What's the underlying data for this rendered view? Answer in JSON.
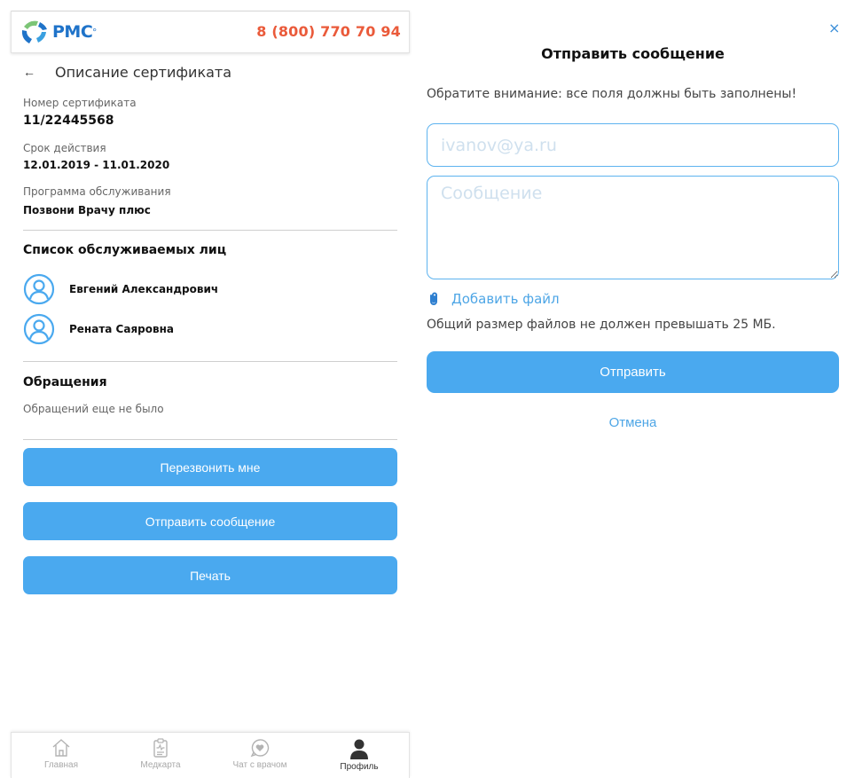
{
  "header": {
    "logo_text": "PMC",
    "logo_mark": "°",
    "phone": "8 (800) 770 70 94"
  },
  "certificate": {
    "back_icon": "←",
    "title": "Описание сертификата",
    "number_label": "Номер сертификата",
    "number_value": "11/22445568",
    "validity_label": "Срок действия",
    "validity_value": "12.01.2019 - 11.01.2020",
    "program_label": "Программа обслуживания",
    "program_value": "Позвони Врачу плюс"
  },
  "persons": {
    "title": "Список обслуживаемых лиц",
    "items": [
      {
        "name": "Евгений Александрович",
        "icon": "user-circle-icon"
      },
      {
        "name": "Рената Саяровна",
        "icon": "user-circle-icon"
      }
    ]
  },
  "requests": {
    "title": "Обращения",
    "empty_text": "Обращений еще не было"
  },
  "actions": {
    "callback": "Перезвонить мне",
    "send_message": "Отправить сообщение",
    "print": "Печать"
  },
  "tabbar": {
    "items": [
      {
        "label": "Главная",
        "icon": "home-icon",
        "active": false
      },
      {
        "label": "Медкарта",
        "icon": "medical-card-icon",
        "active": false
      },
      {
        "label": "Чат с врачом",
        "icon": "chat-heart-icon",
        "active": false
      },
      {
        "label": "Профиль",
        "icon": "profile-icon",
        "active": true
      }
    ]
  },
  "modal": {
    "close": "×",
    "title": "Отправить сообщение",
    "note": "Обратите внимание: все поля должны быть заполнены!",
    "email_placeholder": "ivanov@ya.ru",
    "email_value": "",
    "message_placeholder": "Сообщение",
    "message_value": "",
    "attach_label": "Добавить файл",
    "attach_icon": "paperclip-icon",
    "size_note": "Общий размер файлов не должен превышать 25 МБ.",
    "send_label": "Отправить",
    "cancel_label": "Отмена"
  },
  "colors": {
    "accent": "#4aa9ef",
    "phone": "#ea5a3a",
    "logo": "#1f73c9",
    "logo_green": "#7cc576"
  }
}
